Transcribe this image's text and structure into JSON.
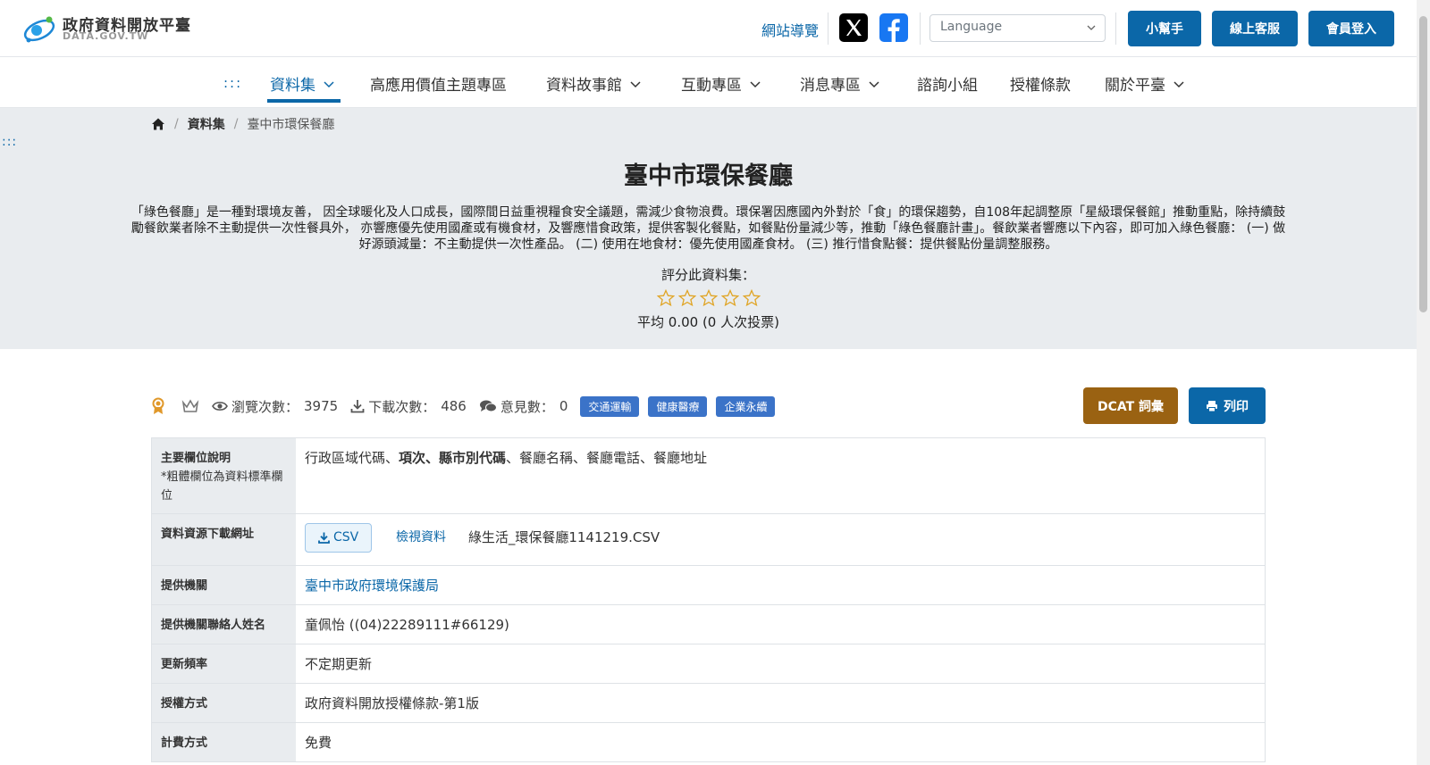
{
  "header": {
    "logo_title": "政府資料開放平臺",
    "logo_subtitle": "DATA.GOV.TW",
    "sitemap": "網站導覽",
    "language_placeholder": "Language",
    "buttons": {
      "helper": "小幫手",
      "service": "線上客服",
      "login": "會員登入"
    }
  },
  "nav": {
    "accesskey": ":::",
    "items": [
      "資料集",
      "高應用價值主題專區",
      "資料故事館",
      "互動專區",
      "消息專區",
      "諮詢小組",
      "授權條款",
      "關於平臺"
    ]
  },
  "breadcrumb": {
    "level1": "資料集",
    "current": "臺中市環保餐廳"
  },
  "hero": {
    "accesskey": ":::",
    "title": "臺中市環保餐廳",
    "description": "「綠色餐廳」是一種對環境友善， 因全球暖化及人口成長，國際間日益重視糧食安全議題，需減少食物浪費。環保署因應國內外對於「食」的環保趨勢，自108年起調整原「星級環保餐館」推動重點，除持續鼓勵餐飲業者除不主動提供一次性餐具外， 亦響應優先使用國產或有機食材，及響應惜食政策，提供客製化餐點，如餐點份量減少等，推動「綠色餐廳計畫」。餐飲業者響應以下內容，即可加入綠色餐廳： (一) 做好源頭減量：不主動提供一次性產品。 (二) 使用在地食材：優先使用國產食材。 (三) 推行惜食點餐：提供餐點份量調整服務。",
    "rate_label": "評分此資料集：",
    "rating_stars": 0,
    "rate_average": "平均 0.00 (0 人次投票)"
  },
  "stats": {
    "views_label": "瀏覽次數：",
    "views": "3975",
    "downloads_label": "下載次數：",
    "downloads": "486",
    "comments_label": "意見數：",
    "comments": "0",
    "tags": [
      "交通運輸",
      "健康醫療",
      "企業永續"
    ]
  },
  "actions": {
    "dcat": "DCAT 詞彙",
    "print": "列印"
  },
  "info": {
    "fields_label": "主要欄位說明",
    "fields_note": "*粗體欄位為資料標準欄位",
    "fields_part1": "行政區域代碼、",
    "fields_bold": "項次、縣市別代碼",
    "fields_part2": "、餐廳名稱、餐廳電話、餐廳地址",
    "download_label": "資料資源下載網址",
    "csv_label": "CSV",
    "view_data": "檢視資料",
    "filename": "綠生活_環保餐廳1141219.CSV",
    "provider_label": "提供機關",
    "provider": "臺中市政府環境保護局",
    "contact_label": "提供機關聯絡人姓名",
    "contact": "童佩怡 ((04)22289111#66129)",
    "frequency_label": "更新頻率",
    "frequency": "不定期更新",
    "license_label": "授權方式",
    "license": "政府資料開放授權條款-第1版",
    "fee_label": "計費方式",
    "fee": "免費"
  },
  "colors": {
    "primary": "#0b67a8",
    "dcat": "#9a6212",
    "tag": "#3b73c8",
    "hero_bg": "#e9ecef",
    "star": "#e0a526"
  }
}
